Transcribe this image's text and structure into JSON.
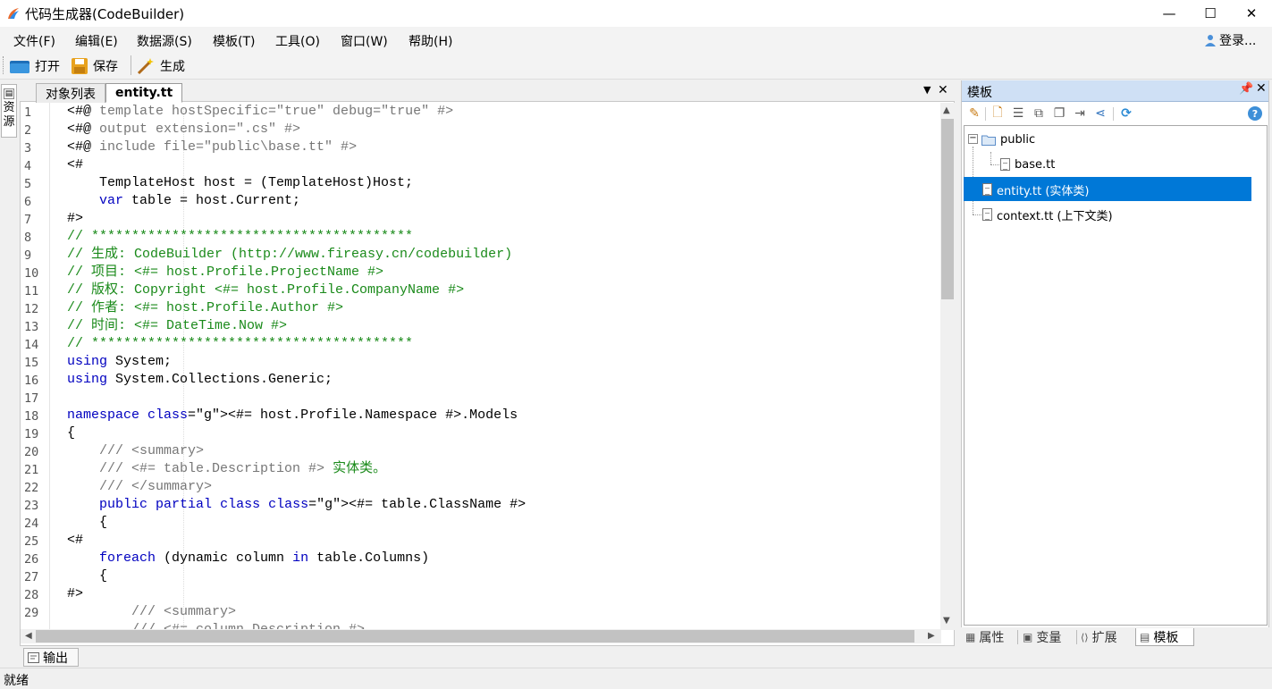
{
  "window": {
    "title": "代码生成器(CodeBuilder)",
    "minimize": "—",
    "maximize": "☐",
    "close": "✕"
  },
  "menu": [
    "文件(F)",
    "编辑(E)",
    "数据源(S)",
    "模板(T)",
    "工具(O)",
    "窗口(W)",
    "帮助(H)"
  ],
  "user": {
    "label": "登录..."
  },
  "toolbar": {
    "open": "打开",
    "save": "保存",
    "generate": "生成"
  },
  "left_strip": {
    "resources_tab": "资源"
  },
  "doc_tabs": {
    "items": [
      "对象列表",
      "entity.tt"
    ],
    "active": "entity.tt"
  },
  "editor": {
    "line_numbers": [
      "1",
      "2",
      "3",
      "4",
      "5",
      "6",
      "7",
      "8",
      "9",
      "10",
      "11",
      "12",
      "13",
      "14",
      "15",
      "16",
      "17",
      "18",
      "19",
      "20",
      "21",
      "22",
      "23",
      "24",
      "25",
      "26",
      "27",
      "28",
      "29"
    ],
    "lines": [
      "<#@ template hostSpecific=\"true\" debug=\"true\" #>",
      "<#@ output extension=\".cs\" #>",
      "<#@ include file=\"public\\base.tt\" #>",
      "<#",
      "    TemplateHost host = (TemplateHost)Host;",
      "    var table = host.Current;",
      "#>",
      "// ****************************************",
      "// 生成: CodeBuilder (http://www.fireasy.cn/codebuilder)",
      "// 项目: <#= host.Profile.ProjectName #>",
      "// 版权: Copyright <#= host.Profile.CompanyName #>",
      "// 作者: <#= host.Profile.Author #>",
      "// 时间: <#= DateTime.Now #>",
      "// ****************************************",
      "using System;",
      "using System.Collections.Generic;",
      "",
      "namespace <#= host.Profile.Namespace #>.Models",
      "{",
      "    /// <summary>",
      "    /// <#= table.Description #> 实体类。",
      "    /// </summary>",
      "    public partial class <#= table.ClassName #>",
      "    {",
      "<#",
      "    foreach (dynamic column in table.Columns)",
      "    {",
      "#>",
      "        /// <summary>"
    ],
    "partial_last_line": "        /// <#= column.Description #>"
  },
  "output_tab": "输出",
  "status": "就绪",
  "right_panel": {
    "title": "模板",
    "tree": [
      {
        "label": "public",
        "type": "folder",
        "level": 0
      },
      {
        "label": "base.tt",
        "type": "file",
        "level": 1
      },
      {
        "label": "entity.tt (实体类)",
        "type": "file",
        "level": 0,
        "selected": true
      },
      {
        "label": "context.tt (上下文类)",
        "type": "file",
        "level": 0
      }
    ],
    "bottom_tabs": [
      "属性",
      "变量",
      "扩展",
      "模板"
    ],
    "active_bottom_tab": "模板"
  },
  "colors": {
    "keyword": "#0000c0",
    "comment": "#1a8a1a",
    "directive": "#777777",
    "selection": "#0078d7",
    "panel_header": "#cfe0f5"
  }
}
